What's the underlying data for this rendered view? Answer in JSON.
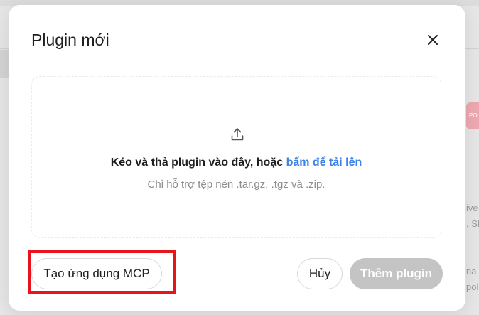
{
  "background": {
    "avatar_text": "PO",
    "side_texts": [
      "ive",
      ", SI",
      "na",
      "pol"
    ]
  },
  "dialog": {
    "title": "Plugin mới",
    "close_icon": "close-icon"
  },
  "dropzone": {
    "icon": "upload-icon",
    "text_prefix": "Kéo và thả plugin vào đây, hoặc ",
    "link_text": "bấm để tải lên",
    "hint": "Chỉ hỗ trợ tệp nén .tar.gz, .tgz và .zip."
  },
  "footer": {
    "create_mcp_label": "Tạo ứng dụng MCP",
    "cancel_label": "Hủy",
    "add_plugin_label": "Thêm plugin"
  },
  "colors": {
    "link": "#3b82e6",
    "highlight": "#e8141c",
    "disabled_button": "#c4c4c4"
  }
}
